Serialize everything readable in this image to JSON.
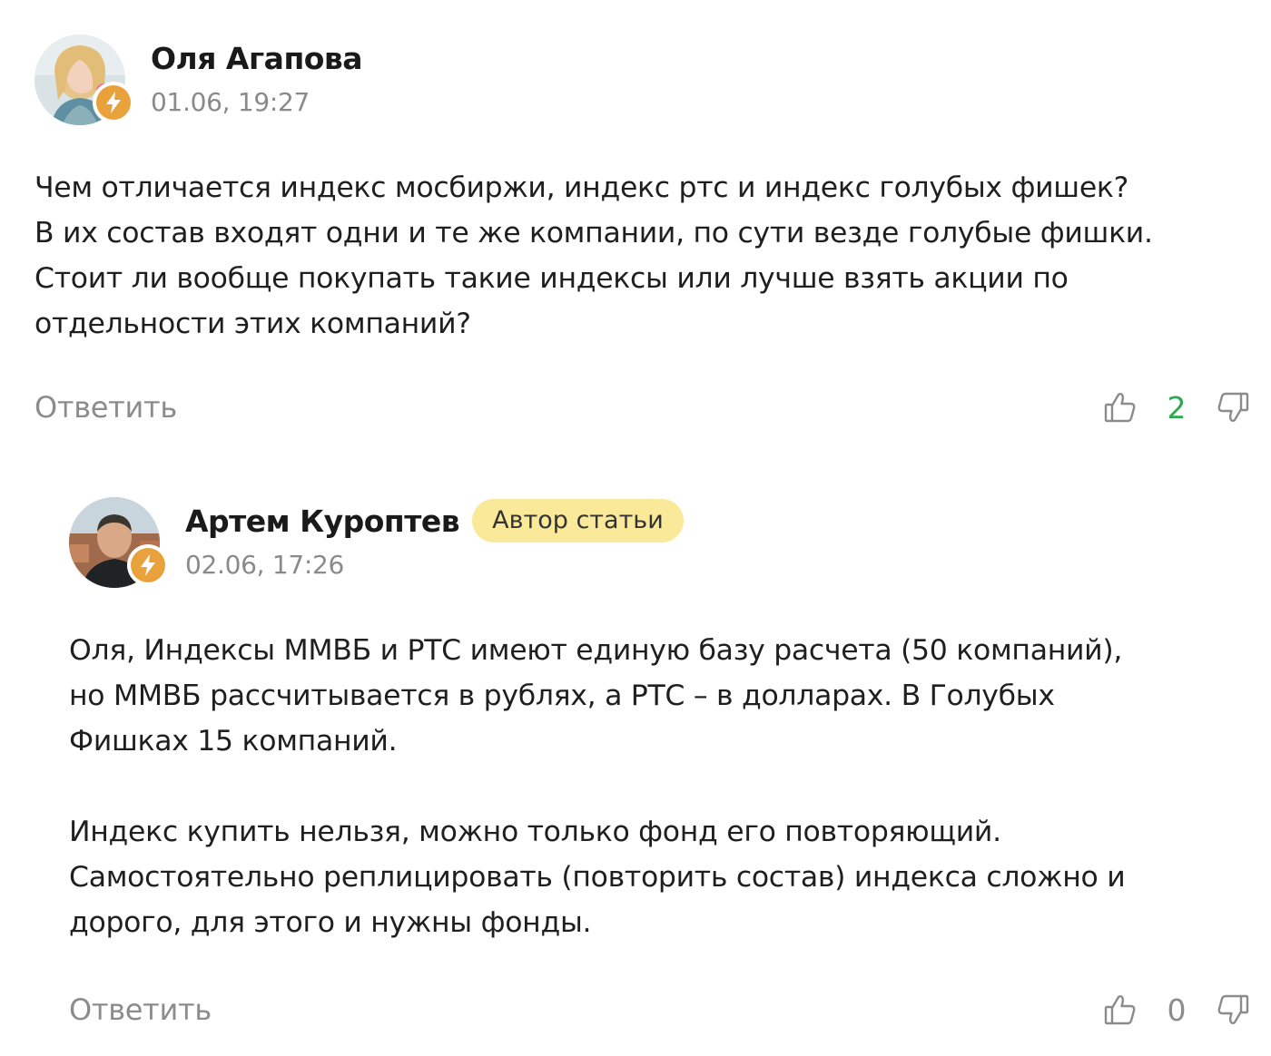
{
  "comments": [
    {
      "author": "Оля Агапова",
      "timestamp": "01.06, 19:27",
      "paragraphs": [
        "Чем отличается индекс мосбиржи, индекс ртс и индекс голубых фишек?\nВ их состав входят одни и те же компании, по сути везде голубые фишки.\nСтоит ли вообще покупать такие индексы или лучше взять акции по\nотдельности этих компаний?"
      ],
      "reply_label": "Ответить",
      "rating": "2",
      "avatar_icon": "user-photo-woman",
      "badge_icon": "lightning-icon"
    },
    {
      "author": "Артем Куроптев",
      "author_tag": "Автор статьи",
      "timestamp": "02.06, 17:26",
      "paragraphs": [
        "Оля, Индексы ММВБ и РТС имеют единую базу расчета (50 компаний),\nно ММВБ рассчитывается в рублях, а РТС – в долларах. В Голубых\nФишках 15 компаний.",
        "Индекс купить нельзя, можно только фонд его повторяющий.\nСамостоятельно реплицировать (повторить состав) индекса сложно и\nдорого, для этого и нужны фонды."
      ],
      "reply_label": "Ответить",
      "rating": "0",
      "avatar_icon": "user-photo-man",
      "badge_icon": "lightning-icon"
    }
  ],
  "colors": {
    "badge_orange": "#e9a23b",
    "author_tag_bg": "#fbe99a",
    "rating_positive": "#2fa84f",
    "muted": "#8c8c8c"
  },
  "icons": {
    "like": "thumbs-up-icon",
    "dislike": "thumbs-down-icon"
  }
}
